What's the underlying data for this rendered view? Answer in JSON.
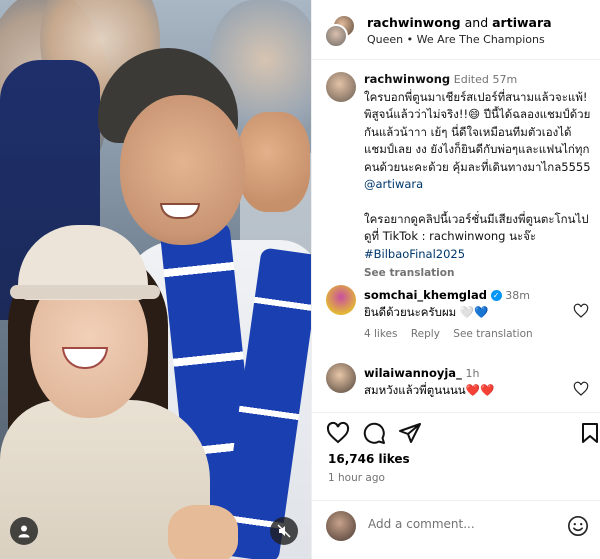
{
  "header": {
    "author": "rachwinwong",
    "and_text": "and",
    "coauthor": "artiwara",
    "music": "Queen • We Are The Champions"
  },
  "caption": {
    "username": "rachwinwong",
    "edited": "Edited",
    "age": "57m",
    "text_part1": "ใครบอกพี่ตูนมาเชียร์สเปอร์ที่สนามแล้วจะแพ้! พิสูจน์แล้วว่าไม่จริง!!😄 ปีนี้ได้ฉลองแชมป์ด้วยกันแล้วน้าาา เย้ๆ นี่ดีใจเหมือนทีมตัวเองได้แชมป์เลย งง ยังไงก็ยินดีกับพ่อๆและแฟนไก่ทุกคนด้วยนะคะด้วย คุ้มละที่เดินทางมาไกล5555",
    "mention": "@artiwara",
    "text_part2": "ใครอยากดูคลิปนี้เวอร์ชั่นมีเสียงพี่ตูนตะโกนไปดูที่ TikTok : rachwinwong นะจ๊ะ",
    "hashtag": "#BilbaoFinal2025",
    "see_translation": "See translation"
  },
  "comments": [
    {
      "username": "somchai_khemglad",
      "verified_mark": "✓",
      "age": "38m",
      "text": "ยินดีด้วยนะครับผม 🤍💙",
      "likes": "4 likes",
      "reply": "Reply",
      "see_translation": "See translation"
    },
    {
      "username": "wilaiwannoyja_",
      "age": "1h",
      "text": "สมหวังแล้วพี่ตูนนนน❤️❤️"
    }
  ],
  "post": {
    "likes": "16,746 likes",
    "time": "1 hour ago"
  },
  "add_comment": {
    "placeholder": "Add a comment..."
  },
  "colors": {
    "link": "#00376b",
    "verified": "#0095f6",
    "muted": "#737373",
    "border": "#efefef"
  },
  "icons": [
    "heart-icon",
    "comment-icon",
    "share-icon",
    "save-icon",
    "emoji-icon",
    "user-tag-icon",
    "mute-icon",
    "verified-badge-icon"
  ]
}
